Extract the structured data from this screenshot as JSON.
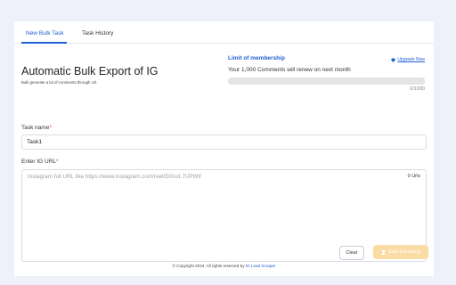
{
  "tabs": [
    {
      "label": "New Bulk Task",
      "active": true
    },
    {
      "label": "Task History",
      "active": false
    }
  ],
  "header": {
    "title": "Automatic Bulk Export of IG",
    "subtitle": "Bulk generate a lot of comments through Url."
  },
  "membership": {
    "title": "Limit of membership",
    "upgrade_label": "Upgrade Now",
    "upgrade_icon": "diamond-icon",
    "renew_text": "Your 1,000 Comments will renew on next month",
    "used": 0,
    "limit": 1000,
    "progress_fraction": 0,
    "count_text": "0/1000"
  },
  "form": {
    "task_name_label": "Task name",
    "required_mark": "*",
    "task_name_value": "Task1",
    "url_label": "Enter IG URL",
    "url_placeholder": "Instagram full URL like https://www.instagram.com/reel/DGvvL7UPWf/",
    "url_count": "0 Urls"
  },
  "actions": {
    "clear_label": "Clear",
    "start_label": "Start Extracting",
    "start_icon": "hourglass-icon"
  },
  "footer": {
    "copyright": "© Copyright 2024. All rights reserved by ",
    "brand": "IG Lead Scraper"
  },
  "colors": {
    "accent": "#1f5fd6",
    "required": "#e0463d",
    "start_button_bg": "#fbdca4",
    "page_bg": "#eef1f9"
  }
}
